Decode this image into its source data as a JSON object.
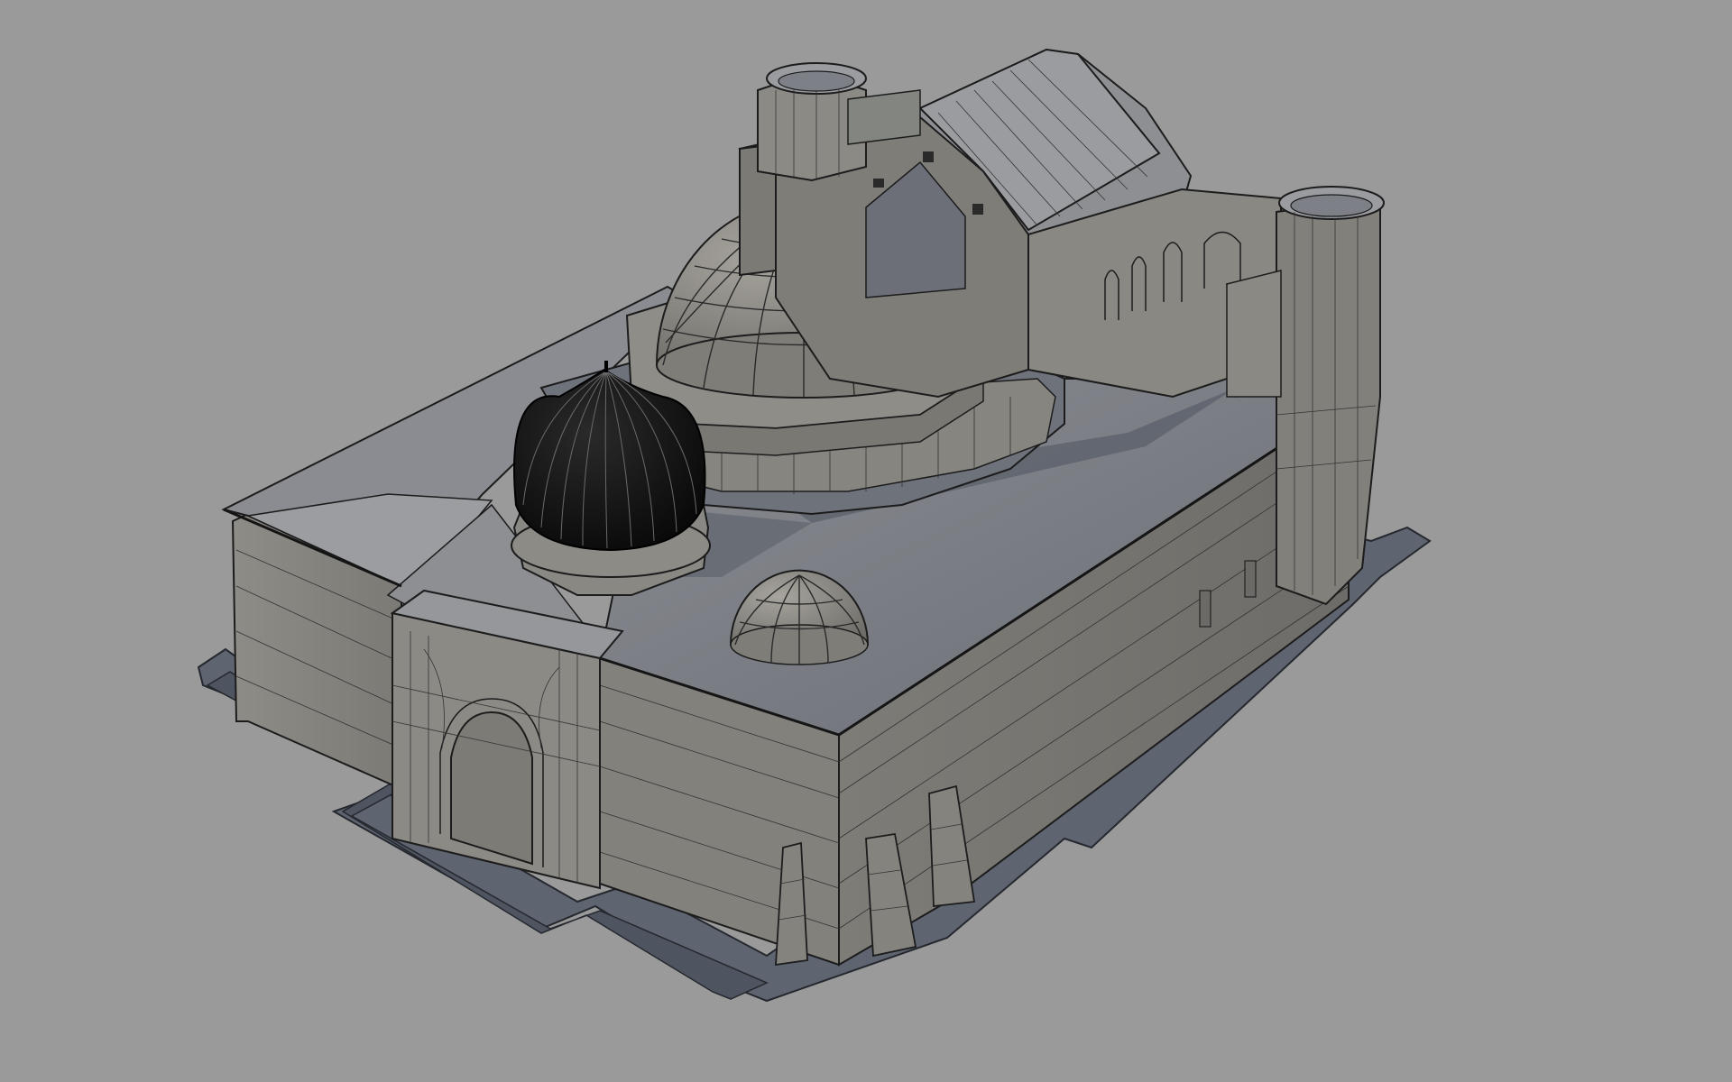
{
  "viewport": {
    "background_color": "#9a9a9a",
    "render_mode": "shaded-wireframe",
    "colors": {
      "base_plate": "#5e6470",
      "base_plate_edge": "#3b3f47",
      "wall_light": "#8e8c86",
      "wall_mid": "#7c7a75",
      "wall_dark": "#6d6b67",
      "roof_light": "#84868b",
      "roof_shadow": "#5a5e68",
      "dome": "#8d8b86",
      "dome_dark": "#111111",
      "wire": "#2a2a2a"
    }
  },
  "scene": {
    "model": "mosque-building-3d-model",
    "parts": [
      "base-plate-icon",
      "outer-wall-icon",
      "main-dome-icon",
      "ribbed-dome-icon",
      "small-dome-icon",
      "entrance-portal-icon",
      "rear-tower-left-icon",
      "rear-tower-right-icon",
      "rear-vaulted-hall-icon",
      "buttress-icon"
    ]
  }
}
